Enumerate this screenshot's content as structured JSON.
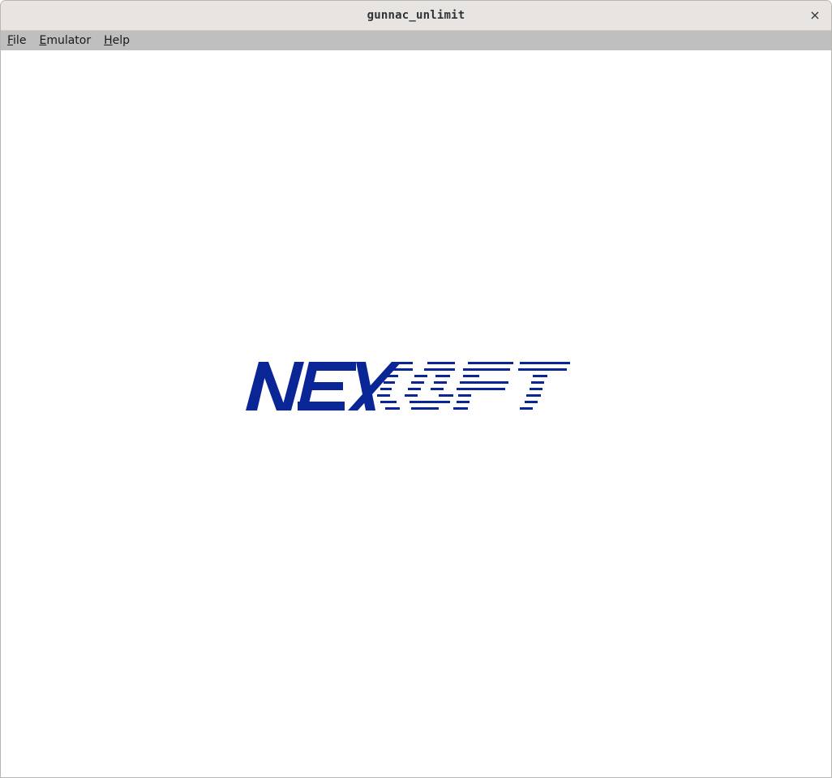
{
  "window": {
    "title": "gunnac_unlimit",
    "close_symbol": "×"
  },
  "menubar": {
    "items": [
      {
        "mnemonic": "F",
        "rest": "ile"
      },
      {
        "mnemonic": "E",
        "rest": "mulator"
      },
      {
        "mnemonic": "H",
        "rest": "elp"
      }
    ]
  },
  "game": {
    "logo_text": "NEXOFT",
    "logo_color": "#0a2596",
    "background": "#ffffff"
  }
}
